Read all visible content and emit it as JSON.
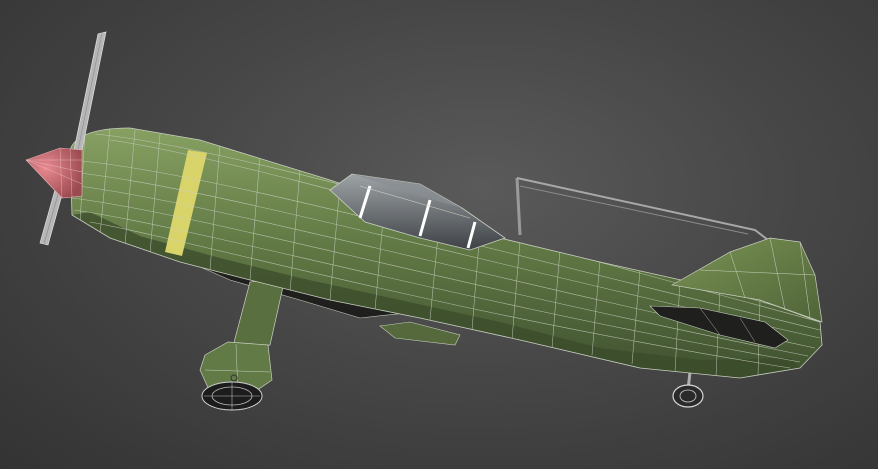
{
  "viewport": {
    "view": "perspective-wireframe-shaded",
    "background": "#4a4a4a"
  },
  "model": {
    "subject": "propeller-fighter-aircraft",
    "colors": {
      "body": "#5d7242",
      "body_light": "#7c9257",
      "body_shadow": "#3e4f2c",
      "underside": "#1e1f1c",
      "stripe": "#d9d46a",
      "spinner": "#c9656b",
      "glass": "#6e7377",
      "wire": "#c9cfc2",
      "metal": "#a9a9a9"
    }
  }
}
